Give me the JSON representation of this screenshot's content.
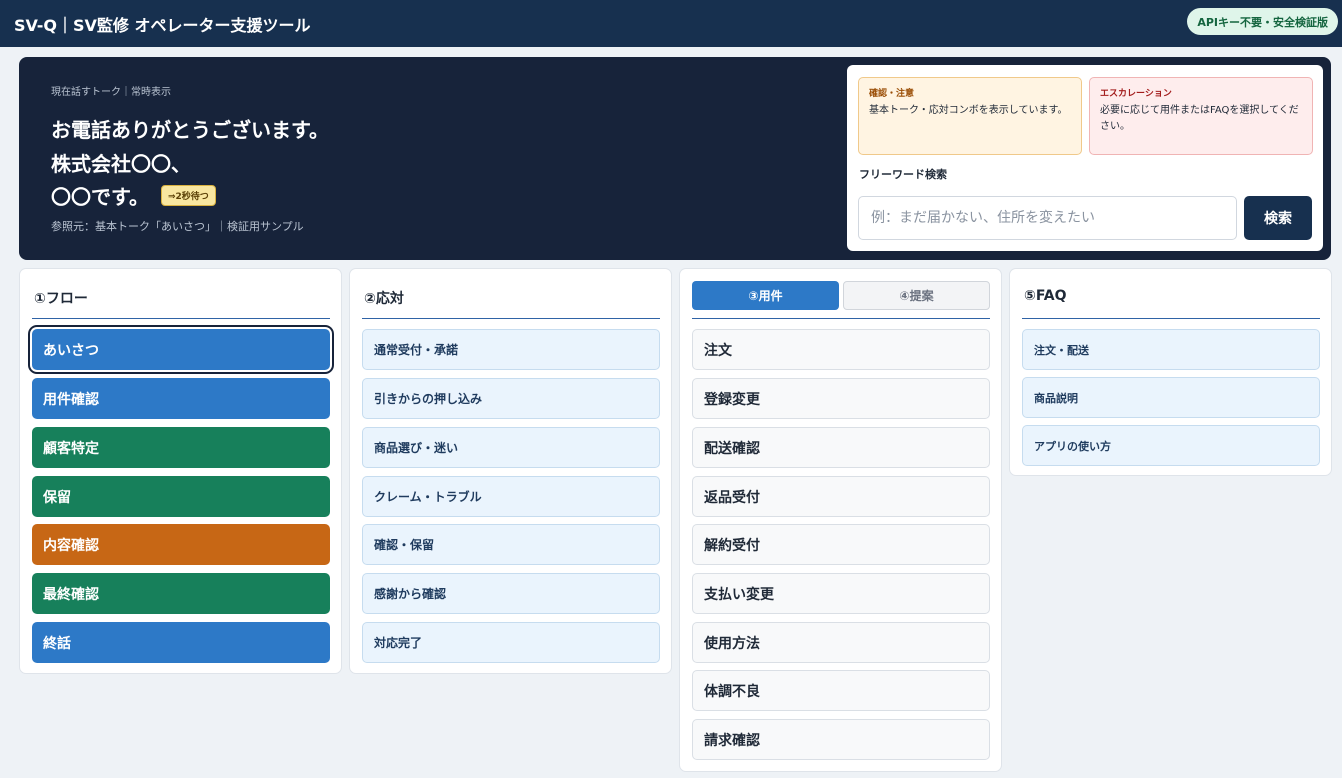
{
  "header": {
    "title": "SV-Q｜SV監修 オペレーター支援ツール",
    "badge": "APIキー不要・安全検証版"
  },
  "hero": {
    "label": "現在話すトーク｜常時表示",
    "lines": [
      "お電話ありがとうございます。",
      "株式会社〇〇、",
      "〇〇です。"
    ],
    "wait_badge": "⇒2秒待つ",
    "source": "参照元：基本トーク「あいさつ」｜検証用サンプル"
  },
  "notices": {
    "caution": {
      "title": "確認・注意",
      "body": "基本トーク・応対コンボを表示しています。"
    },
    "escalation": {
      "title": "エスカレーション",
      "body": "必要に応じて用件またはFAQを選択してください。"
    }
  },
  "search": {
    "label": "フリーワード検索",
    "placeholder": "例：まだ届かない、住所を変えたい",
    "value": "",
    "button": "検索"
  },
  "flow": {
    "title": "①フロー",
    "items": [
      {
        "label": "あいさつ",
        "color": "#2d79c7",
        "selected": true
      },
      {
        "label": "用件確認",
        "color": "#2d79c7"
      },
      {
        "label": "顧客特定",
        "color": "#17805b"
      },
      {
        "label": "保留",
        "color": "#17805b"
      },
      {
        "label": "内容確認",
        "color": "#c76715"
      },
      {
        "label": "最終確認",
        "color": "#17805b"
      },
      {
        "label": "終話",
        "color": "#2d79c7"
      }
    ]
  },
  "response": {
    "title": "②応対",
    "items": [
      "通常受付・承諾",
      "引きからの押し込み",
      "商品選び・迷い",
      "クレーム・トラブル",
      "確認・保留",
      "感謝から確認",
      "対応完了"
    ]
  },
  "business": {
    "tabs": [
      {
        "label": "③用件",
        "active": true
      },
      {
        "label": "④提案",
        "active": false
      }
    ],
    "items": [
      "注文",
      "登録変更",
      "配送確認",
      "返品受付",
      "解約受付",
      "支払い変更",
      "使用方法",
      "体調不良",
      "請求確認"
    ]
  },
  "faq": {
    "title": "⑤FAQ",
    "items": [
      "注文・配送",
      "商品説明",
      "アプリの使い方"
    ]
  }
}
